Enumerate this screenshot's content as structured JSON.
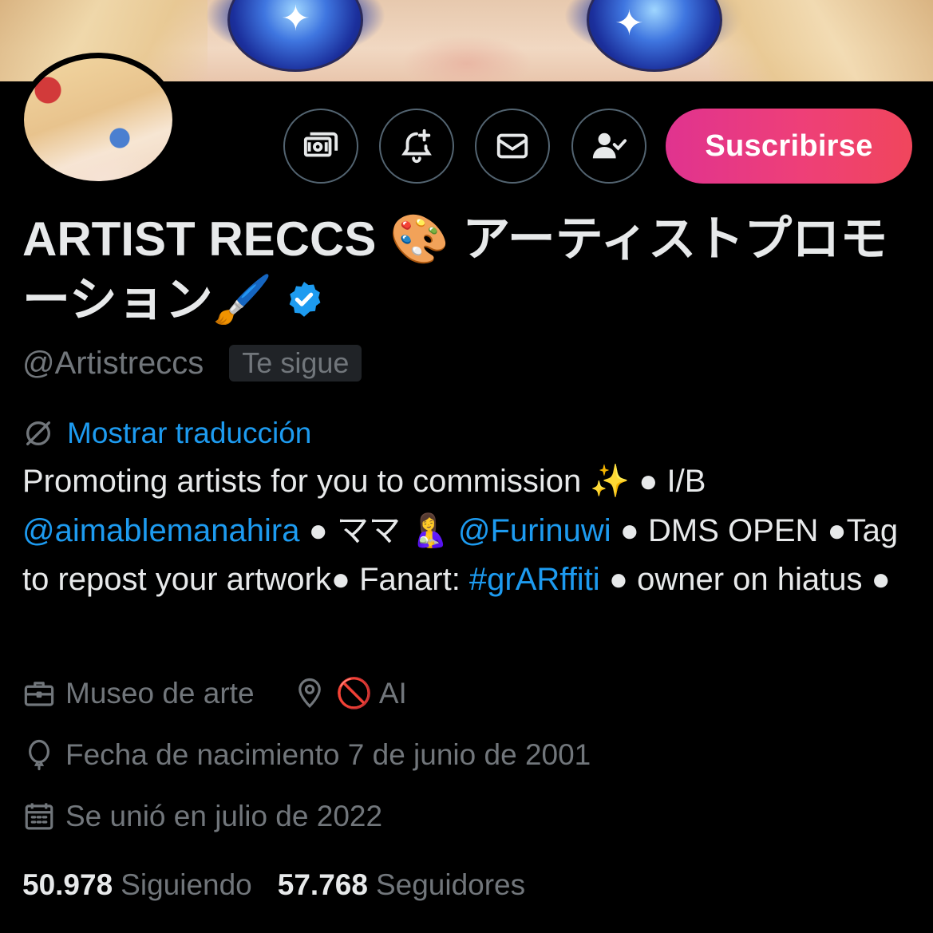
{
  "profile": {
    "display_name": "ARTIST RECCS 🎨 アーティストプロモーション🖌️",
    "handle": "@Artistreccs",
    "follows_you_label": "Te sigue",
    "verified": true,
    "banner_description": "anime artwork with blue sparkling eyes",
    "avatar_description": "anime character with blonde hair winking"
  },
  "actions": {
    "tip_label": "tip",
    "notify_label": "notifications",
    "message_label": "message",
    "following_label": "following",
    "subscribe_label": "Suscribirse"
  },
  "translate": {
    "label": "Mostrar traducción"
  },
  "bio": {
    "t1": "Promoting artists for you to commission ✨ ● I/B ",
    "mention1": "@aimablemanahira",
    "t2": " ● ママ 🤱 ",
    "mention2": "@Furinuwi",
    "t3": " ● DMS OPEN ●Tag to repost your artwork● Fanart: ",
    "hashtag": "#grARffiti",
    "t4": " ● owner on hiatus ●"
  },
  "meta": {
    "category": "Museo de arte",
    "location": "🚫 AI",
    "birthday": "Fecha de nacimiento 7 de junio de 2001",
    "joined": "Se unió en julio de 2022"
  },
  "stats": {
    "following_count": "50.978",
    "following_label": "Siguiendo",
    "followers_count": "57.768",
    "followers_label": "Seguidores"
  },
  "colors": {
    "background": "#000000",
    "text_primary": "#e7e9ea",
    "text_secondary": "#71767b",
    "link": "#1d9bf0",
    "subscribe_start": "#e0338f",
    "subscribe_end": "#f0465c",
    "verified": "#1d9bf0"
  },
  "icons": [
    "money-icon",
    "bell-plus-icon",
    "envelope-icon",
    "person-check-icon",
    "verified-badge-icon",
    "translate-icon",
    "briefcase-icon",
    "location-pin-icon",
    "balloon-icon",
    "calendar-icon"
  ]
}
